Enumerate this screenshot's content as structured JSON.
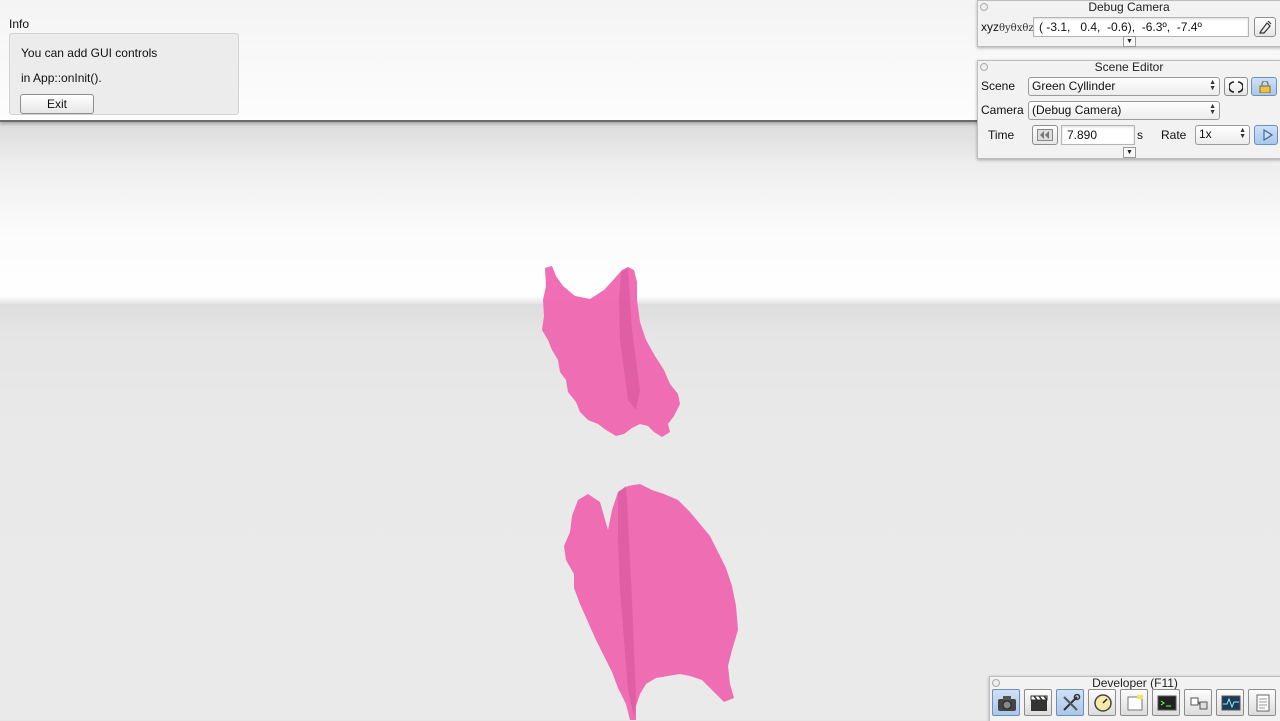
{
  "info_pane": {
    "title": "Info",
    "line1": "You can add GUI controls",
    "line2": "in App::onInit().",
    "exit_label": "Exit"
  },
  "debug_camera": {
    "title": "Debug Camera",
    "label": "xyzθᵧθₓθᵪ",
    "label_main": "xyz",
    "label_sub": "θyθxθz",
    "value": "( -3.1,   0.4,  -0.6),  -6.3º,  -7.4º"
  },
  "scene_editor": {
    "title": "Scene Editor",
    "scene_label": "Scene",
    "scene_value": "Green Cyllinder",
    "camera_label": "Camera",
    "camera_value": "(Debug Camera)",
    "time_label": "Time",
    "time_value": "7.890",
    "time_unit": "s",
    "rate_label": "Rate",
    "rate_value": "1x"
  },
  "developer": {
    "title": "Developer (F11)",
    "icons": [
      "camera-icon",
      "film-clapper-icon",
      "tools-icon",
      "speed-gauge-icon",
      "note-icon",
      "terminal-icon",
      "scene-graph-icon",
      "profiler-icon",
      "log-icon"
    ]
  },
  "colors": {
    "object_pink": "#ee66b0",
    "selection_blue": "#a9c6ea"
  }
}
